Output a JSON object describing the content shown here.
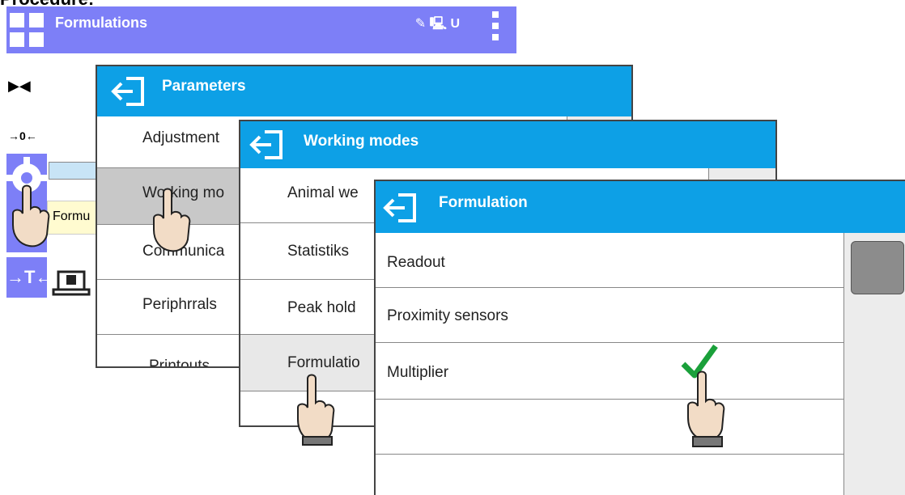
{
  "caption": "Procedure:",
  "main": {
    "title": "Formulations",
    "status_icons": "✎ 🖳 U",
    "strip_label": "Formu",
    "side_symbols": {
      "center": "▶◀",
      "zero": "→0←",
      "tare": "→T←"
    }
  },
  "parameters": {
    "title": "Parameters",
    "items": [
      "Adjustment",
      "Working mo",
      "Communica",
      "Periphrrals",
      "Printouts"
    ]
  },
  "working_modes": {
    "title": "Working modes",
    "items": [
      "Animal we",
      "Statistiks",
      "Peak hold",
      "Formulatio"
    ]
  },
  "formulation": {
    "title": "Formulation",
    "items": [
      "Readout",
      "Proximity sensors",
      "Multiplier",
      "",
      ""
    ],
    "checked_item": "Multiplier"
  },
  "colors": {
    "header_blue": "#0da0e6",
    "main_header": "#7d7ff7",
    "check_green": "#1aa03a"
  }
}
